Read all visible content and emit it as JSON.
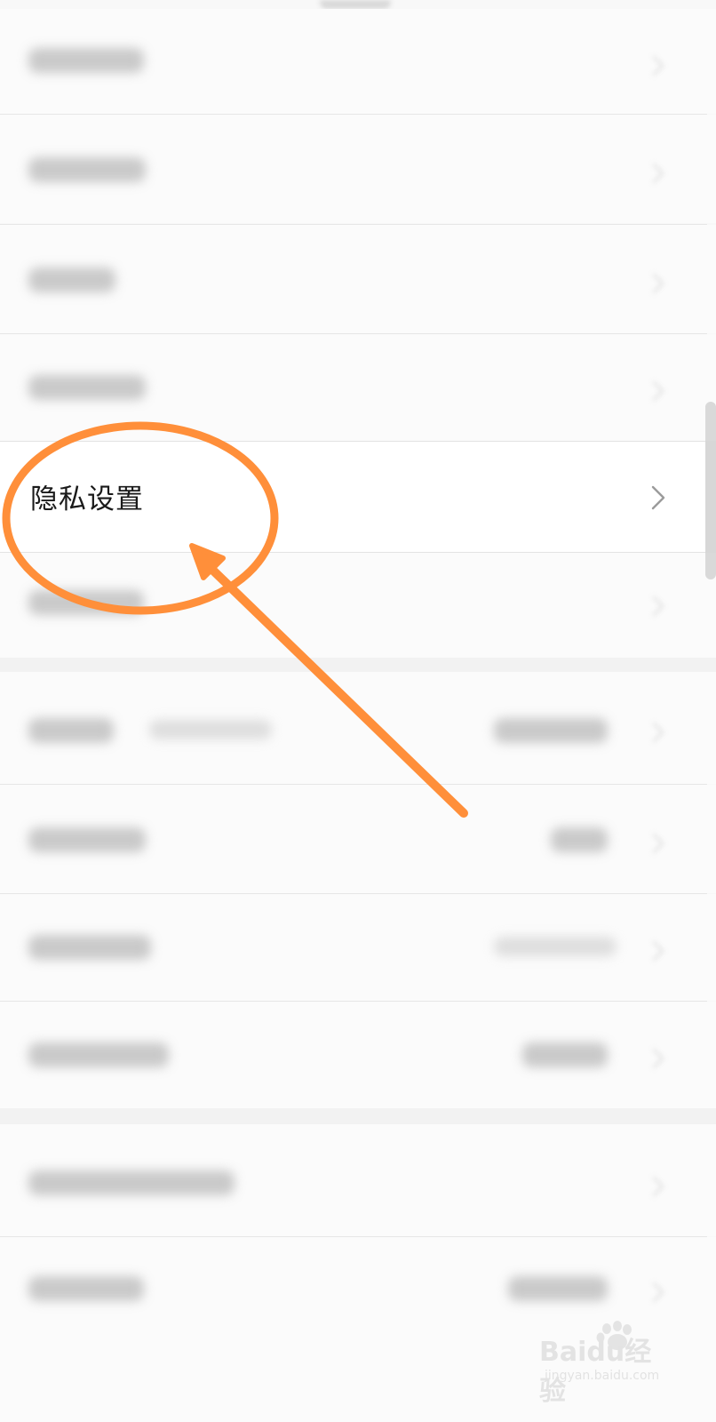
{
  "settings_list": {
    "highlighted_item": {
      "label": "隐私设置",
      "chevron_icon": "chevron-right-icon"
    }
  },
  "annotation": {
    "color": "#FF8F3A",
    "shapes": [
      "ellipse",
      "arrow"
    ]
  },
  "watermark": {
    "brand": "Baidu经验",
    "site": "jingyan.baidu.com"
  }
}
